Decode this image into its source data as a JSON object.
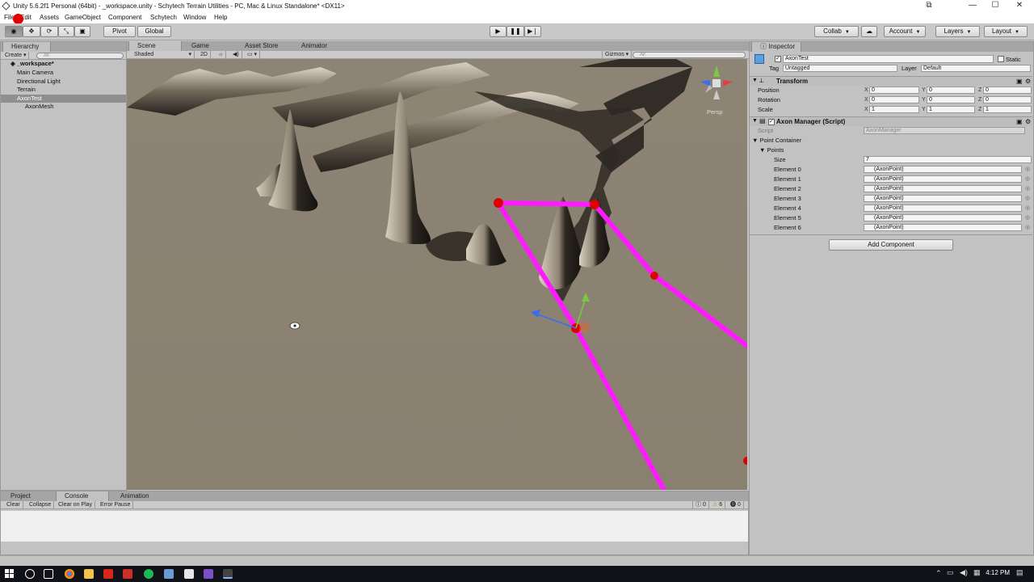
{
  "window": {
    "title": "Unity 5.6.2f1 Personal (64bit) - _workspace.unity - Schytech Terrain Utilities - PC, Mac & Linux Standalone* <DX11>"
  },
  "menu": [
    "File",
    "Edit",
    "Assets",
    "GameObject",
    "Component",
    "Schytech",
    "Window",
    "Help"
  ],
  "toolbar": {
    "pivot": "Pivot",
    "global": "Global",
    "collab": "Collab",
    "account": "Account",
    "layers": "Layers",
    "layout": "Layout"
  },
  "hierarchy": {
    "tab": "Hierarchy",
    "create": "Create",
    "search_placeholder": "All",
    "scene": "_workspace*",
    "items": [
      "Main Camera",
      "Directional Light",
      "Terrain",
      "AxonTest",
      "AxonMesh"
    ]
  },
  "scene": {
    "tabs": [
      "Scene",
      "Game",
      "Asset Store",
      "Animator"
    ],
    "shading": "Shaded",
    "mode2d": "2D",
    "gizmos": "Gizmos",
    "search_placeholder": "All",
    "persp": "Persp"
  },
  "inspector": {
    "tab": "Inspector",
    "object_name": "AxonTest",
    "static_label": "Static",
    "tag_label": "Tag",
    "tag_value": "Untagged",
    "layer_label": "Layer",
    "layer_value": "Default",
    "transform": {
      "title": "Transform",
      "position_label": "Position",
      "rotation_label": "Rotation",
      "scale_label": "Scale",
      "position": [
        "0",
        "0",
        "0"
      ],
      "rotation": [
        "0",
        "0",
        "0"
      ],
      "scale": [
        "1",
        "1",
        "1"
      ]
    },
    "axon_manager": {
      "title": "Axon Manager (Script)",
      "script_label": "Script",
      "script_value": "AxonManager",
      "point_container": "Point Container",
      "points": "Points",
      "size_label": "Size",
      "size_value": "7",
      "elements": [
        {
          "label": "Element 0",
          "value": "(AxonPoint)"
        },
        {
          "label": "Element 1",
          "value": "(AxonPoint)"
        },
        {
          "label": "Element 2",
          "value": "(AxonPoint)"
        },
        {
          "label": "Element 3",
          "value": "(AxonPoint)"
        },
        {
          "label": "Element 4",
          "value": "(AxonPoint)"
        },
        {
          "label": "Element 5",
          "value": "(AxonPoint)"
        },
        {
          "label": "Element 6",
          "value": "(AxonPoint)"
        }
      ]
    },
    "add_component": "Add Component"
  },
  "bottom": {
    "tabs": [
      "Project",
      "Console",
      "Animation"
    ],
    "buttons": [
      "Clear",
      "Collapse",
      "Clear on Play",
      "Error Pause"
    ],
    "counts": {
      "info": "0",
      "warn": "6",
      "error": "0"
    }
  },
  "taskbar": {
    "time": "4:12 PM"
  }
}
